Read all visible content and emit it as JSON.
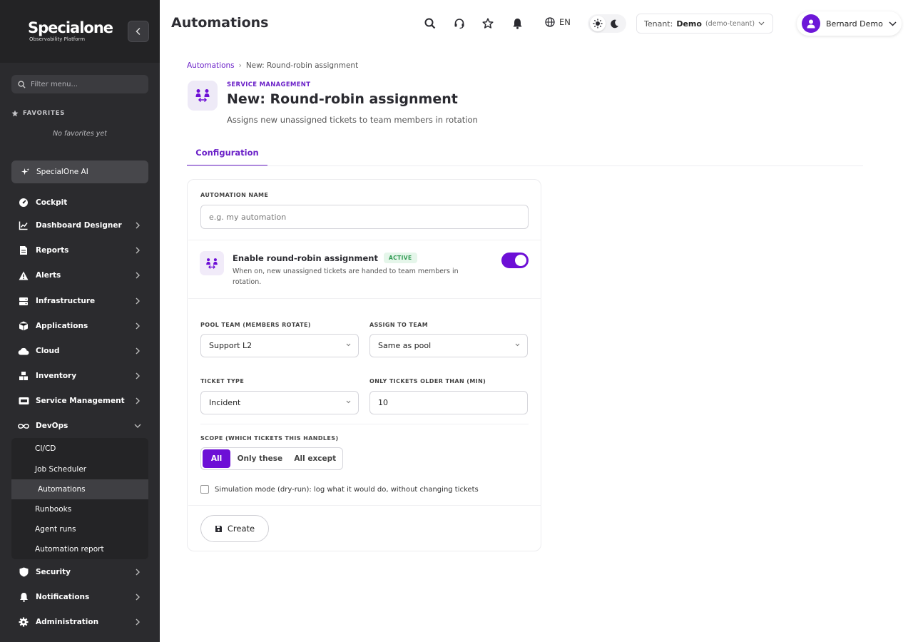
{
  "sidebar": {
    "logo_text": "Specialone",
    "logo_tagline": "Observability Platform",
    "filter_placeholder": "Filter menu...",
    "favorites_heading": "FAVORITES",
    "favorites_empty": "No favorites yet",
    "ai_label": "SpecialOne AI",
    "items": [
      {
        "label": "Cockpit",
        "icon": "gauge-icon"
      },
      {
        "label": "Dashboard Designer",
        "icon": "chart-line-icon"
      },
      {
        "label": "Reports",
        "icon": "document-icon"
      },
      {
        "label": "Alerts",
        "icon": "warning-icon"
      },
      {
        "label": "Infrastructure",
        "icon": "server-icon"
      },
      {
        "label": "Applications",
        "icon": "cube-icon"
      },
      {
        "label": "Cloud",
        "icon": "cloud-icon"
      },
      {
        "label": "Inventory",
        "icon": "boxes-icon"
      },
      {
        "label": "Service Management",
        "icon": "ticket-icon"
      },
      {
        "label": "DevOps",
        "icon": "infinity-icon"
      },
      {
        "label": "Security",
        "icon": "shield-icon"
      },
      {
        "label": "Notifications",
        "icon": "bell-icon"
      },
      {
        "label": "Administration",
        "icon": "gear-icon"
      }
    ],
    "devops_children": [
      "CI/CD",
      "Job Scheduler",
      "Automations",
      "Runbooks",
      "Agent runs",
      "Automation report"
    ]
  },
  "header": {
    "title": "Automations",
    "language": "EN",
    "tenant_key": "Tenant:",
    "tenant_name": "Demo",
    "tenant_slug": "(demo-tenant)",
    "user_name": "Bernard Demo"
  },
  "breadcrumb": {
    "parent": "Automations",
    "current": "New: Round-robin assignment"
  },
  "page": {
    "category": "SERVICE MANAGEMENT",
    "title": "New: Round-robin assignment",
    "subtitle": "Assigns new unassigned tickets to team members in rotation",
    "tab": "Configuration"
  },
  "form": {
    "name_label": "AUTOMATION NAME",
    "name_placeholder": "e.g. my automation",
    "enable_title": "Enable round-robin assignment",
    "enable_badge": "ACTIVE",
    "enable_desc": "When on, new unassigned tickets are handed to team members in rotation.",
    "enabled": true,
    "pool_label": "POOL TEAM (MEMBERS ROTATE)",
    "pool_value": "Support L2",
    "assign_label": "ASSIGN TO TEAM",
    "assign_value": "Same as pool",
    "type_label": "TICKET TYPE",
    "type_value": "Incident",
    "older_label": "ONLY TICKETS OLDER THAN (MIN)",
    "older_value": "10",
    "scope_label": "SCOPE (WHICH TICKETS THIS HANDLES)",
    "scope_options": [
      "All",
      "Only these",
      "All except"
    ],
    "simulation_label": "Simulation mode (dry-run): log what it would do, without changing tickets",
    "create_label": "Create"
  },
  "colors": {
    "accent": "#6d0fd6",
    "sidebar": "#2b2b2e",
    "active_badge": "#2f9a52"
  }
}
